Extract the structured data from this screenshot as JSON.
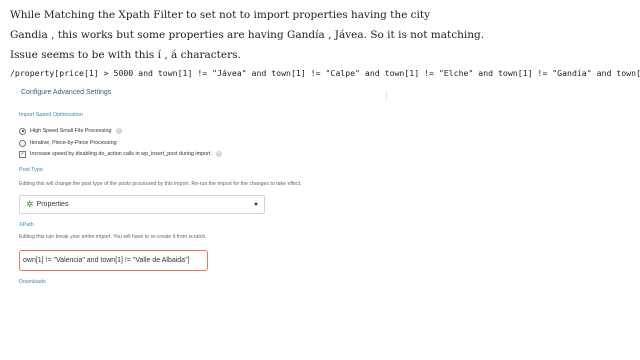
{
  "question": {
    "line1": "While Matching the Xpath Filter to set not to import properties having the city",
    "line2": "Gandia , this works but some properties are having Gandía , Jávea. So it is not matching.",
    "line3": "Issue seems to be with this í , á characters.",
    "code": "/property[price[1] > 5000 and town[1] != \"Jávea\" and town[1] != \"Calpe\" and town[1] != \"Elche\" and town[1] != \"Gandía\" and town[1] != \"Oliva\" and town[1] != \"Valencia\" and town[1] != \"Valle de Albaida\"]"
  },
  "panel": {
    "title": "Configure Advanced Settings",
    "import_speed": {
      "label": "Import Speed Optimization",
      "options": [
        {
          "label": "High Speed Small File Processing",
          "type": "radio",
          "checked": true,
          "help": true
        },
        {
          "label": "Iterative, Piece-by-Piece Processing",
          "type": "radio",
          "checked": false,
          "help": false
        },
        {
          "label": "Increase speed by disabling do_action calls in wp_insert_post during import.",
          "type": "checkbox",
          "checked": true,
          "help": true
        }
      ]
    },
    "post_type": {
      "label": "Post Type",
      "helper": "Editing this will change the post type of the posts processed by this import. Re-run the import for the changes to take effect.",
      "selected": "Properties",
      "icon": "gear-icon"
    },
    "xpath": {
      "label": "XPath",
      "helper": "Editing this can break your entire import. You will have to re-create it from scratch.",
      "visible_value": "own[1] != \"Valencia\" and town[1] != \"Valle de Albaida\"]"
    },
    "downloads": {
      "label": "Downloads"
    }
  },
  "colors": {
    "section_label": "#3a87b8",
    "title": "#2e5d8a",
    "input_error_border": "#e07a5f",
    "gear": "#3f8a3f"
  }
}
